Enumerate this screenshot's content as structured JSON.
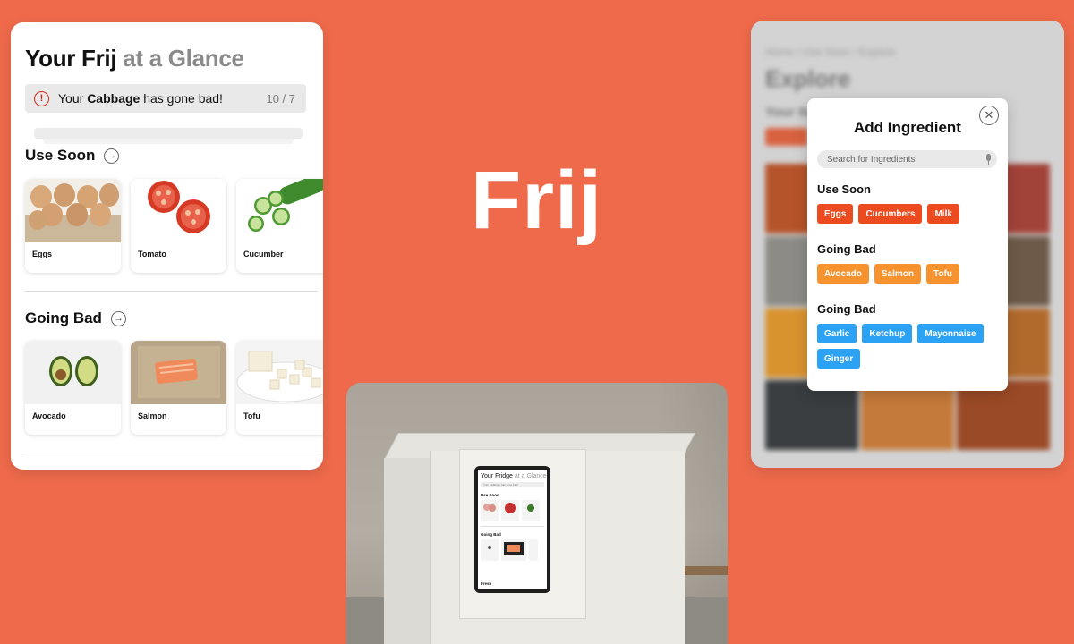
{
  "colors": {
    "background": "#ee6a4b",
    "use_soon_tag": "#ec4a1f",
    "going_bad_tag": "#f7932e",
    "other_tag": "#2ba2f3",
    "alert_red": "#d6261a"
  },
  "brand": {
    "name": "Frij"
  },
  "glance_card": {
    "title_main": "Your Frij",
    "title_muted": "at a Glance",
    "alert": {
      "icon": "alert-circle-icon",
      "prefix": "Your ",
      "item": "Cabbage",
      "suffix": " has gone bad!",
      "count": "10 / 7"
    },
    "sections": [
      {
        "title": "Use Soon",
        "icon": "arrow-right-circle-icon",
        "items": [
          {
            "name": "Eggs"
          },
          {
            "name": "Tomato"
          },
          {
            "name": "Cucumber"
          }
        ]
      },
      {
        "title": "Going Bad",
        "icon": "arrow-right-circle-icon",
        "items": [
          {
            "name": "Avocado"
          },
          {
            "name": "Salmon"
          },
          {
            "name": "Tofu"
          }
        ]
      }
    ]
  },
  "tablet": {
    "title_main": "Your Fridge",
    "title_muted": "at a Glance",
    "alert": "Your Cabbage has gone bad!",
    "section_1": "Use Soon",
    "section_2": "Going Bad",
    "section_3": "Fresh"
  },
  "explore_card": {
    "breadcrumb": "Home / Use Soon / Explore",
    "title": "Explore",
    "subtitle": "Your Ite",
    "modal": {
      "title": "Add Ingredient",
      "close_icon": "close-circle-icon",
      "search_placeholder": "Search for Ingredients",
      "search_value": "",
      "mic_icon": "microphone-icon",
      "groups": [
        {
          "title": "Use Soon",
          "tags": [
            "Eggs",
            "Cucumbers",
            "Milk"
          ]
        },
        {
          "title": "Going Bad",
          "tags": [
            "Avocado",
            "Salmon",
            "Tofu"
          ]
        },
        {
          "title": "Going Bad",
          "tags": [
            "Garlic",
            "Ketchup",
            "Mayonnaise",
            "Ginger"
          ]
        }
      ]
    }
  }
}
